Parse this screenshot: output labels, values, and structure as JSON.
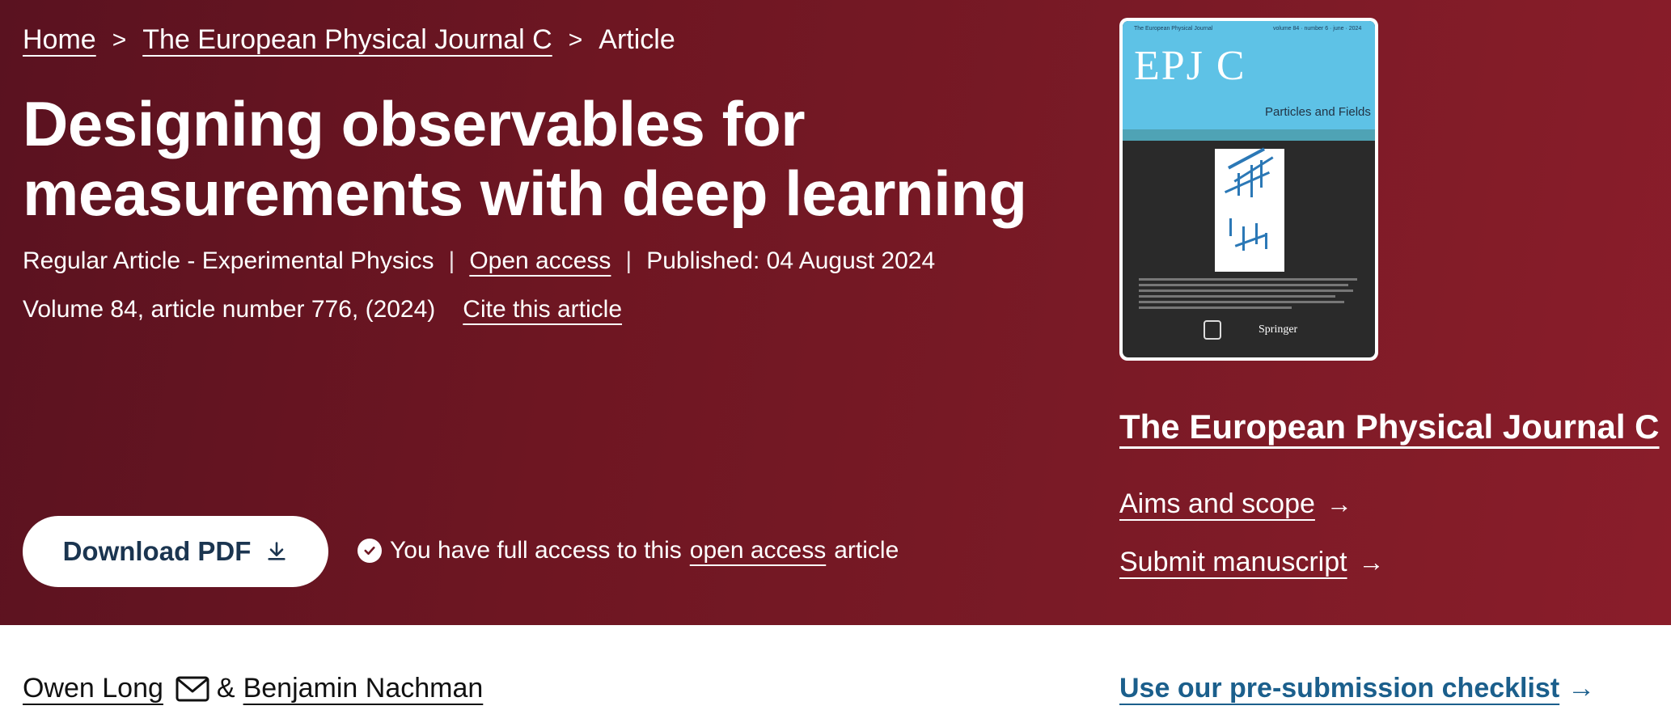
{
  "breadcrumb": {
    "items": [
      "Home",
      "The European Physical Journal C"
    ],
    "current": "Article",
    "separator": ">"
  },
  "article": {
    "title": "Designing observables for measurements with deep learning",
    "type": "Regular Article - Experimental Physics",
    "open_access": "Open access",
    "published": "Published: 04 August 2024",
    "citation": "Volume 84, article number 776, (2024)",
    "cite_link": "Cite this article"
  },
  "actions": {
    "download_label": "Download PDF",
    "access_prefix": "You have full access to this",
    "access_link": "open access",
    "access_suffix": "article"
  },
  "cover": {
    "small_left": "The European Physical Journal",
    "small_right": "volume 84 · number 6 · june · 2024",
    "title": "EPJ C",
    "subtitle": "Particles and Fields",
    "publisher": "Springer"
  },
  "sidebar": {
    "journal_name": "The European Physical Journal C",
    "aims": "Aims and scope",
    "submit": "Submit manuscript",
    "checklist": "Use our pre-submission checklist"
  },
  "authors": {
    "first": "Owen Long",
    "amp": "&",
    "second": "Benjamin Nachman"
  },
  "colors": {
    "hero_dark": "#5a1220",
    "hero_light": "#8a1d2a",
    "button_text": "#1b3550",
    "link_blue": "#1b5f8c",
    "cover_blue": "#5ec2e6"
  },
  "icons": [
    "download-icon",
    "check-circle-icon",
    "arrow-right-icon",
    "mail-icon",
    "chevron-right-icon"
  ]
}
